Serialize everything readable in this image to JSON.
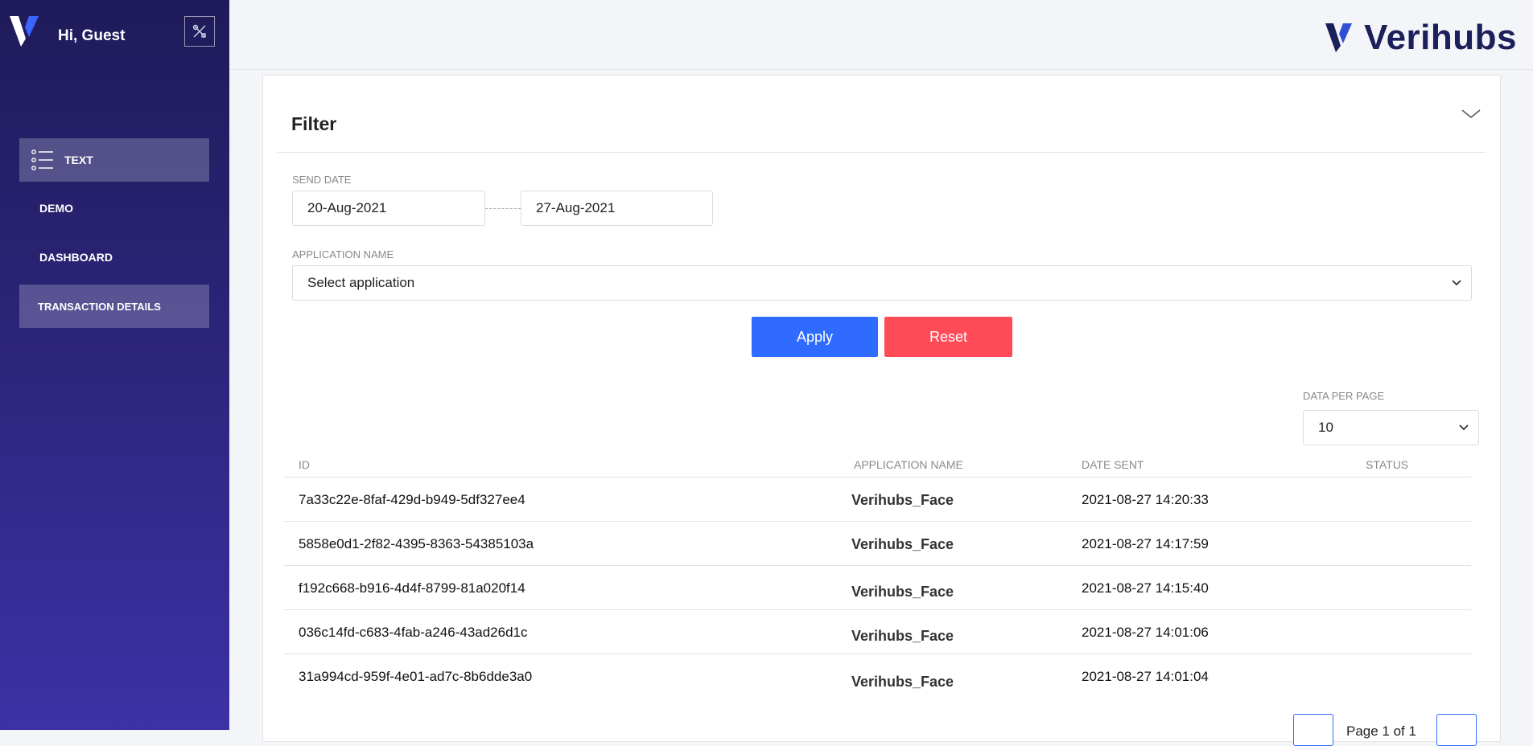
{
  "sidebar": {
    "greeting": "Hi, Guest",
    "items": [
      {
        "label": "TEXT",
        "icon": "list-icon",
        "active": true
      },
      {
        "label": "DEMO",
        "active": false
      },
      {
        "label": "DASHBOARD",
        "active": false
      },
      {
        "label": "TRANSACTION DETAILS",
        "active": true
      }
    ]
  },
  "header": {
    "brand": "Verihubs",
    "accent": "#1b1f5a",
    "brand_blue": "#2f4fd6"
  },
  "filter": {
    "title": "Filter",
    "send_date_label": "SEND DATE",
    "date_from": "20-Aug-2021",
    "date_to": "27-Aug-2021",
    "app_name_label": "APPLICATION NAME",
    "app_select": "Select application",
    "apply_label": "Apply",
    "reset_label": "Reset",
    "apply_color": "#2f6bff",
    "reset_color": "#ff4a57"
  },
  "table": {
    "per_page_label": "DATA PER PAGE",
    "per_page_value": "10",
    "headers": {
      "id": "ID",
      "app": "APPLICATION NAME",
      "date": "DATE SENT",
      "status": "STATUS"
    },
    "rows": [
      {
        "id": "7a33c22e-8faf-429d-b949-5df327ee4",
        "app": "Verihubs_Face",
        "date": "2021-08-27 14:20:33",
        "status": ""
      },
      {
        "id": "5858e0d1-2f82-4395-8363-54385103a",
        "app": "Verihubs_Face",
        "date": "2021-08-27 14:17:59",
        "status": ""
      },
      {
        "id": "f192c668-b916-4d4f-8799-81a020f14",
        "app": "Verihubs_Face",
        "date": "2021-08-27 14:15:40",
        "status": ""
      },
      {
        "id": "036c14fd-c683-4fab-a246-43ad26d1c",
        "app": "Verihubs_Face",
        "date": "2021-08-27 14:01:06",
        "status": ""
      },
      {
        "id": "31a994cd-959f-4e01-ad7c-8b6dde3a0",
        "app": "Verihubs_Face",
        "date": "2021-08-27 14:01:04",
        "status": ""
      }
    ],
    "pagination": "Page 1 of 1"
  }
}
